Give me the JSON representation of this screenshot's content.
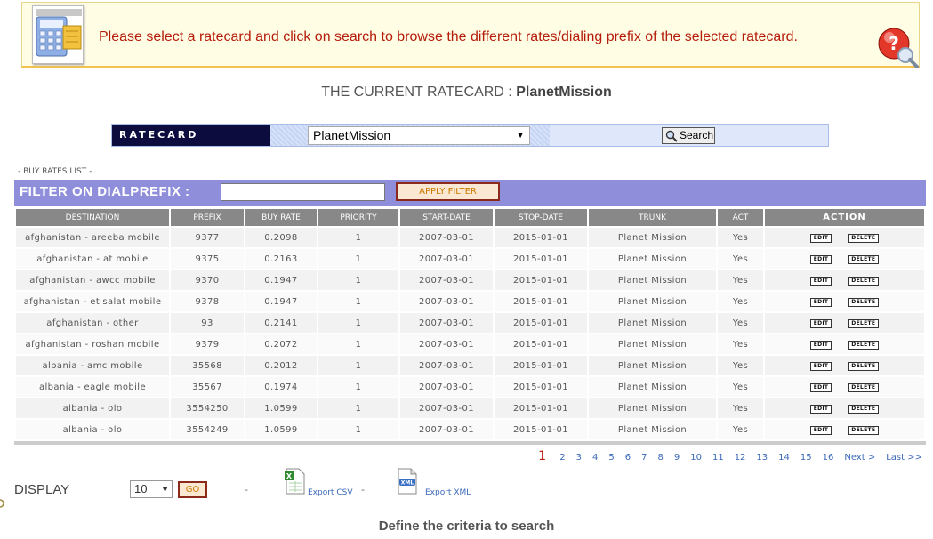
{
  "notice": {
    "text": "Please select a ratecard and click on search to browse the different rates/dialing prefix of the selected ratecard."
  },
  "current_ratecard": {
    "prefix": "THE CURRENT RATECARD : ",
    "name": "PlanetMission"
  },
  "ratecard_bar": {
    "label": "RATECARD",
    "selected": "PlanetMission",
    "search_label": "Search"
  },
  "buy_rates_label": "- BUY RATES LIST -",
  "filter": {
    "label": "FILTER ON DIALPREFIX :",
    "value": "",
    "apply_label": "APPLY FILTER"
  },
  "table": {
    "columns": [
      "DESTINATION",
      "PREFIX",
      "BUY RATE",
      "PRIORITY",
      "START-DATE",
      "STOP-DATE",
      "TRUNK",
      "ACT",
      "ACTION"
    ],
    "edit_label": "EDIT",
    "delete_label": "DELETE",
    "rows": [
      [
        "afghanistan - areeba mobile",
        "9377",
        "0.2098",
        "1",
        "2007-03-01",
        "2015-01-01",
        "Planet Mission",
        "Yes"
      ],
      [
        "afghanistan - at mobile",
        "9375",
        "0.2163",
        "1",
        "2007-03-01",
        "2015-01-01",
        "Planet Mission",
        "Yes"
      ],
      [
        "afghanistan - awcc mobile",
        "9370",
        "0.1947",
        "1",
        "2007-03-01",
        "2015-01-01",
        "Planet Mission",
        "Yes"
      ],
      [
        "afghanistan - etisalat mobile",
        "9378",
        "0.1947",
        "1",
        "2007-03-01",
        "2015-01-01",
        "Planet Mission",
        "Yes"
      ],
      [
        "afghanistan - other",
        "93",
        "0.2141",
        "1",
        "2007-03-01",
        "2015-01-01",
        "Planet Mission",
        "Yes"
      ],
      [
        "afghanistan - roshan mobile",
        "9379",
        "0.2072",
        "1",
        "2007-03-01",
        "2015-01-01",
        "Planet Mission",
        "Yes"
      ],
      [
        "albania - amc mobile",
        "35568",
        "0.2012",
        "1",
        "2007-03-01",
        "2015-01-01",
        "Planet Mission",
        "Yes"
      ],
      [
        "albania - eagle mobile",
        "35567",
        "0.1974",
        "1",
        "2007-03-01",
        "2015-01-01",
        "Planet Mission",
        "Yes"
      ],
      [
        "albania - olo",
        "3554250",
        "1.0599",
        "1",
        "2007-03-01",
        "2015-01-01",
        "Planet Mission",
        "Yes"
      ],
      [
        "albania - olo",
        "3554249",
        "1.0599",
        "1",
        "2007-03-01",
        "2015-01-01",
        "Planet Mission",
        "Yes"
      ]
    ]
  },
  "pager": {
    "current": "1",
    "pages": [
      "2",
      "3",
      "4",
      "5",
      "6",
      "7",
      "8",
      "9",
      "10",
      "11",
      "12",
      "13",
      "14",
      "15",
      "16"
    ],
    "next_label": "Next >",
    "last_label": "Last >>"
  },
  "display": {
    "label": "DISPLAY",
    "selected": "10",
    "go_label": "GO",
    "separator": "-"
  },
  "export": {
    "csv_label": "Export CSV",
    "xml_label": "Export XML",
    "xml_badge": "XML"
  },
  "criteria_text": "Define the criteria to search",
  "icons": {
    "notice": "calculator-spreadsheet-icon",
    "help": "help-magnifier-icon",
    "search": "magnifier-icon",
    "csv": "spreadsheet-file-icon",
    "xml": "xml-file-icon"
  },
  "colors": {
    "notice_text": "#b51c0b",
    "filter_bar": "#8e8edb",
    "header_cell": "#888888",
    "link": "#3a68b8"
  }
}
